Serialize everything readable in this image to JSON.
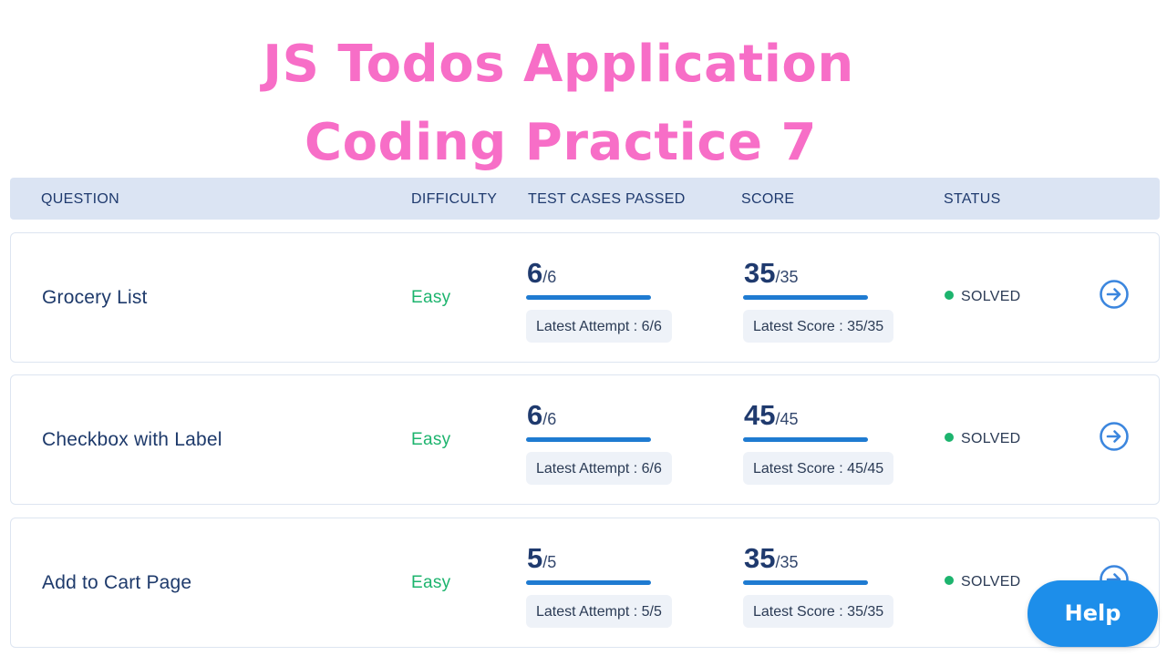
{
  "title": {
    "line1": "JS Todos Application",
    "line2": "Coding Practice 7"
  },
  "table": {
    "headers": {
      "question": "QUESTION",
      "difficulty": "DIFFICULTY",
      "test_cases": "TEST CASES PASSED",
      "score": "SCORE",
      "status": "STATUS"
    },
    "rows": [
      {
        "question": "Grocery List",
        "difficulty": "Easy",
        "tests_passed": "6",
        "tests_total": "/6",
        "latest_attempt": "Latest Attempt : 6/6",
        "score": "35",
        "score_total": "/35",
        "latest_score": "Latest Score : 35/35",
        "status": "SOLVED"
      },
      {
        "question": "Checkbox with Label",
        "difficulty": "Easy",
        "tests_passed": "6",
        "tests_total": "/6",
        "latest_attempt": "Latest Attempt : 6/6",
        "score": "45",
        "score_total": "/45",
        "latest_score": "Latest Score : 45/45",
        "status": "SOLVED"
      },
      {
        "question": "Add to Cart Page",
        "difficulty": "Easy",
        "tests_passed": "5",
        "tests_total": "/5",
        "latest_attempt": "Latest Attempt : 5/5",
        "score": "35",
        "score_total": "/35",
        "latest_score": "Latest Score : 35/35",
        "status": "SOLVED"
      }
    ]
  },
  "help_button": {
    "label": "Help"
  },
  "icons": {
    "row_action": "arrow-right-circle-icon",
    "status": "status-dot-icon"
  },
  "colors": {
    "title": "#f76ec7",
    "easy": "#1db46e",
    "progress": "#1f7bd1",
    "help": "#1d8eea",
    "header_bg": "#dbe4f3"
  }
}
